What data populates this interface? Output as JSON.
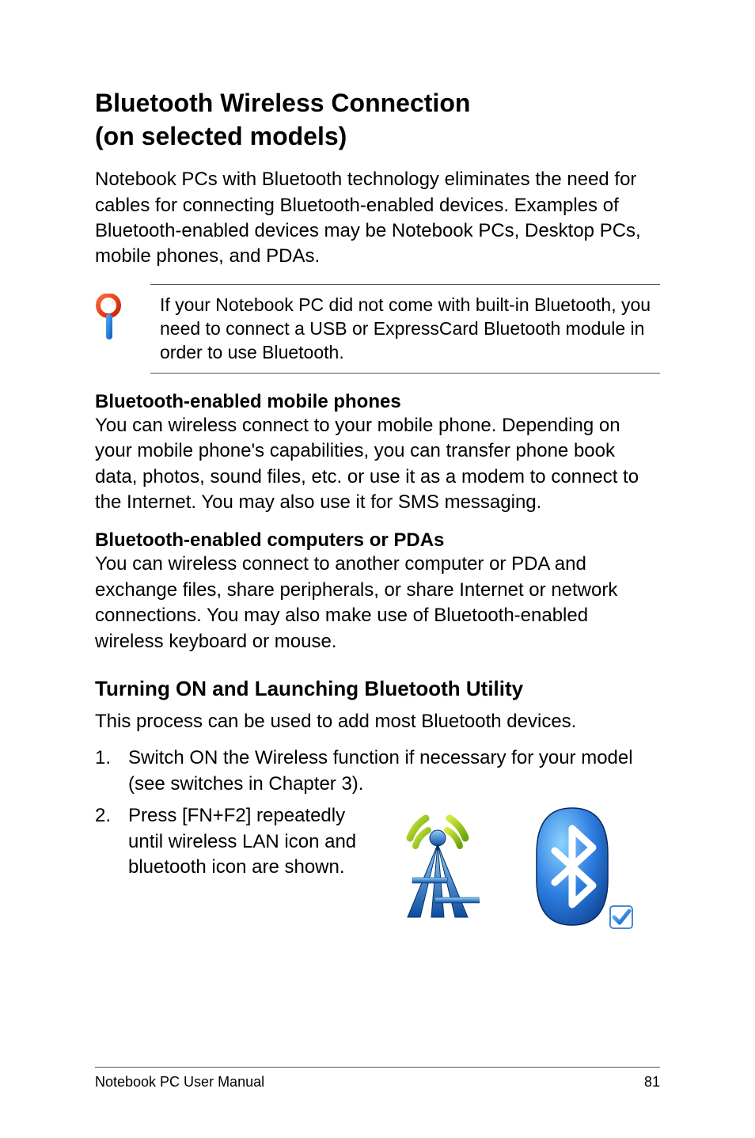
{
  "title_line1": "Bluetooth Wireless Connection",
  "title_line2": "(on selected models)",
  "intro": "Notebook PCs with Bluetooth technology eliminates the need for cables for connecting Bluetooth-enabled devices. Examples of Bluetooth-enabled devices may be Notebook PCs, Desktop PCs, mobile phones, and PDAs.",
  "note": "If your Notebook PC did not come with built-in Bluetooth, you need to connect a USB or ExpressCard Bluetooth module in order to use Bluetooth.",
  "phones_heading": "Bluetooth-enabled mobile phones",
  "phones_body": "You can wireless connect to your mobile phone. Depending on your mobile phone's capabilities, you can transfer phone book data, photos, sound files, etc. or use it as a modem to connect to the Internet. You may also use it for SMS messaging.",
  "computers_heading": "Bluetooth-enabled computers or PDAs",
  "computers_body": "You can wireless connect to another computer or PDA and exchange files, share peripherals, or share Internet or network connections. You may also make use of Bluetooth-enabled wireless keyboard or mouse.",
  "utility_heading": "Turning ON and Launching Bluetooth Utility",
  "utility_intro": "This process can be used to add most Bluetooth devices.",
  "step1": "Switch ON the Wireless function if necessary for your model (see switches in Chapter 3).",
  "step2": "Press [FN+F2] repeatedly until wireless LAN icon and bluetooth icon are shown.",
  "footer_left": "Notebook PC User Manual",
  "footer_right": "81"
}
